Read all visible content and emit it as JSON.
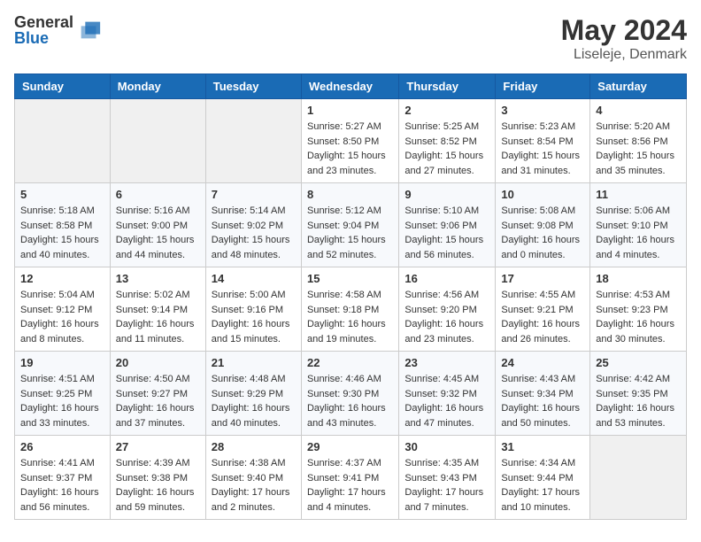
{
  "header": {
    "logo": {
      "general": "General",
      "blue": "Blue"
    },
    "title": "May 2024",
    "location": "Liseleje, Denmark"
  },
  "calendar": {
    "days_of_week": [
      "Sunday",
      "Monday",
      "Tuesday",
      "Wednesday",
      "Thursday",
      "Friday",
      "Saturday"
    ],
    "weeks": [
      [
        {
          "day": null,
          "info": null
        },
        {
          "day": null,
          "info": null
        },
        {
          "day": null,
          "info": null
        },
        {
          "day": "1",
          "info": "Sunrise: 5:27 AM\nSunset: 8:50 PM\nDaylight: 15 hours\nand 23 minutes."
        },
        {
          "day": "2",
          "info": "Sunrise: 5:25 AM\nSunset: 8:52 PM\nDaylight: 15 hours\nand 27 minutes."
        },
        {
          "day": "3",
          "info": "Sunrise: 5:23 AM\nSunset: 8:54 PM\nDaylight: 15 hours\nand 31 minutes."
        },
        {
          "day": "4",
          "info": "Sunrise: 5:20 AM\nSunset: 8:56 PM\nDaylight: 15 hours\nand 35 minutes."
        }
      ],
      [
        {
          "day": "5",
          "info": "Sunrise: 5:18 AM\nSunset: 8:58 PM\nDaylight: 15 hours\nand 40 minutes."
        },
        {
          "day": "6",
          "info": "Sunrise: 5:16 AM\nSunset: 9:00 PM\nDaylight: 15 hours\nand 44 minutes."
        },
        {
          "day": "7",
          "info": "Sunrise: 5:14 AM\nSunset: 9:02 PM\nDaylight: 15 hours\nand 48 minutes."
        },
        {
          "day": "8",
          "info": "Sunrise: 5:12 AM\nSunset: 9:04 PM\nDaylight: 15 hours\nand 52 minutes."
        },
        {
          "day": "9",
          "info": "Sunrise: 5:10 AM\nSunset: 9:06 PM\nDaylight: 15 hours\nand 56 minutes."
        },
        {
          "day": "10",
          "info": "Sunrise: 5:08 AM\nSunset: 9:08 PM\nDaylight: 16 hours\nand 0 minutes."
        },
        {
          "day": "11",
          "info": "Sunrise: 5:06 AM\nSunset: 9:10 PM\nDaylight: 16 hours\nand 4 minutes."
        }
      ],
      [
        {
          "day": "12",
          "info": "Sunrise: 5:04 AM\nSunset: 9:12 PM\nDaylight: 16 hours\nand 8 minutes."
        },
        {
          "day": "13",
          "info": "Sunrise: 5:02 AM\nSunset: 9:14 PM\nDaylight: 16 hours\nand 11 minutes."
        },
        {
          "day": "14",
          "info": "Sunrise: 5:00 AM\nSunset: 9:16 PM\nDaylight: 16 hours\nand 15 minutes."
        },
        {
          "day": "15",
          "info": "Sunrise: 4:58 AM\nSunset: 9:18 PM\nDaylight: 16 hours\nand 19 minutes."
        },
        {
          "day": "16",
          "info": "Sunrise: 4:56 AM\nSunset: 9:20 PM\nDaylight: 16 hours\nand 23 minutes."
        },
        {
          "day": "17",
          "info": "Sunrise: 4:55 AM\nSunset: 9:21 PM\nDaylight: 16 hours\nand 26 minutes."
        },
        {
          "day": "18",
          "info": "Sunrise: 4:53 AM\nSunset: 9:23 PM\nDaylight: 16 hours\nand 30 minutes."
        }
      ],
      [
        {
          "day": "19",
          "info": "Sunrise: 4:51 AM\nSunset: 9:25 PM\nDaylight: 16 hours\nand 33 minutes."
        },
        {
          "day": "20",
          "info": "Sunrise: 4:50 AM\nSunset: 9:27 PM\nDaylight: 16 hours\nand 37 minutes."
        },
        {
          "day": "21",
          "info": "Sunrise: 4:48 AM\nSunset: 9:29 PM\nDaylight: 16 hours\nand 40 minutes."
        },
        {
          "day": "22",
          "info": "Sunrise: 4:46 AM\nSunset: 9:30 PM\nDaylight: 16 hours\nand 43 minutes."
        },
        {
          "day": "23",
          "info": "Sunrise: 4:45 AM\nSunset: 9:32 PM\nDaylight: 16 hours\nand 47 minutes."
        },
        {
          "day": "24",
          "info": "Sunrise: 4:43 AM\nSunset: 9:34 PM\nDaylight: 16 hours\nand 50 minutes."
        },
        {
          "day": "25",
          "info": "Sunrise: 4:42 AM\nSunset: 9:35 PM\nDaylight: 16 hours\nand 53 minutes."
        }
      ],
      [
        {
          "day": "26",
          "info": "Sunrise: 4:41 AM\nSunset: 9:37 PM\nDaylight: 16 hours\nand 56 minutes."
        },
        {
          "day": "27",
          "info": "Sunrise: 4:39 AM\nSunset: 9:38 PM\nDaylight: 16 hours\nand 59 minutes."
        },
        {
          "day": "28",
          "info": "Sunrise: 4:38 AM\nSunset: 9:40 PM\nDaylight: 17 hours\nand 2 minutes."
        },
        {
          "day": "29",
          "info": "Sunrise: 4:37 AM\nSunset: 9:41 PM\nDaylight: 17 hours\nand 4 minutes."
        },
        {
          "day": "30",
          "info": "Sunrise: 4:35 AM\nSunset: 9:43 PM\nDaylight: 17 hours\nand 7 minutes."
        },
        {
          "day": "31",
          "info": "Sunrise: 4:34 AM\nSunset: 9:44 PM\nDaylight: 17 hours\nand 10 minutes."
        },
        {
          "day": null,
          "info": null
        }
      ]
    ]
  }
}
